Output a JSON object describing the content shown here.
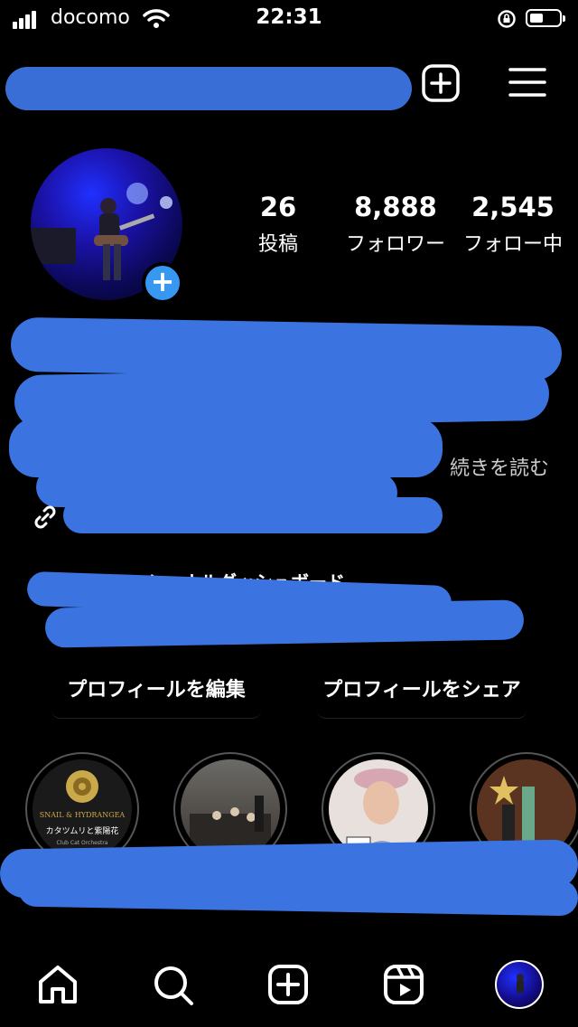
{
  "status_bar": {
    "carrier": "docomo",
    "time": "22:31"
  },
  "stats": {
    "posts": {
      "value": "26",
      "label": "投稿"
    },
    "followers": {
      "value": "8,888",
      "label": "フォロワー"
    },
    "following": {
      "value": "2,545",
      "label": "フォロー中"
    }
  },
  "bio": {
    "read_more": "続きを読む"
  },
  "dashboard": {
    "title": "プロフェッショナルダッシュボード"
  },
  "buttons": {
    "edit_profile": "プロフィールを編集",
    "share_profile": "プロフィールをシェア"
  },
  "highlights": [
    {
      "text_line1": "SNAIL & HYDRANGEA",
      "text_line2": "カタツムリと紫陽花",
      "text_line3": "Club Cat Orchestra"
    }
  ],
  "colors": {
    "accent": "#3897f0",
    "scribble": "#3b74e0",
    "background": "#000000"
  },
  "icons": {
    "header": [
      "new-post-icon",
      "menu-icon"
    ],
    "nav": [
      "home-icon",
      "search-icon",
      "create-icon",
      "reels-icon",
      "profile-avatar"
    ]
  }
}
